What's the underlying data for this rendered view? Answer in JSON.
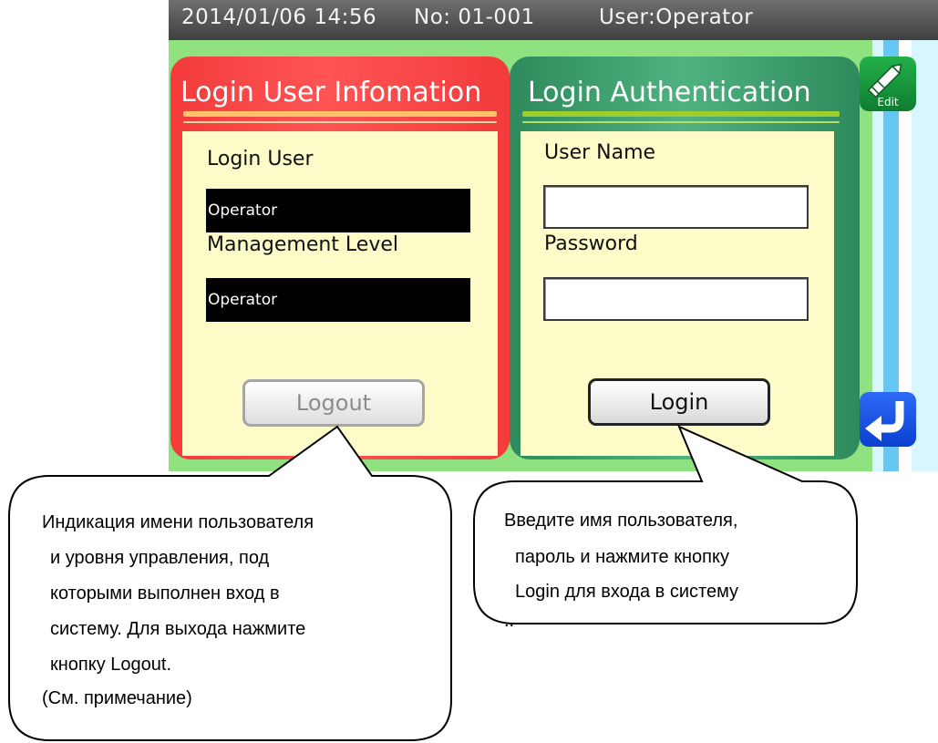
{
  "status_bar": {
    "datetime": "2014/01/06 14:56",
    "number": "No: 01-001",
    "user": "User:Operator"
  },
  "user_info_panel": {
    "title": "Login User Infomation",
    "login_user_label": "Login User",
    "login_user_value": "Operator",
    "management_level_label": "Management Level",
    "management_level_value": "Operator",
    "logout_button": "Logout"
  },
  "auth_panel": {
    "title": "Login Authentication",
    "user_name_label": "User Name",
    "user_name_value": "",
    "password_label": "Password",
    "password_value": "",
    "login_button": "Login"
  },
  "side_buttons": {
    "edit_label": "Edit",
    "edit_icon": "pencil-icon",
    "back_icon": "return-arrow-icon"
  },
  "callouts": {
    "left": {
      "lines": [
        "Индикация имени пользователя",
        "и уровня управления, под",
        "которыми выполнен вход в",
        "систему. Для выхода нажмите",
        "кнопку Logout.",
        "(См. примечание)"
      ]
    },
    "right": {
      "lines": [
        "Введите имя пользователя,",
        "пароль и нажмите  кнопку",
        "Login для входа в систему",
        ".."
      ]
    }
  },
  "colors": {
    "status_bar": "#4f4f4f",
    "screen_background": "#8fe27f",
    "user_panel": "#f33b3b",
    "auth_panel": "#2e8a5c",
    "panel_body": "#fdfbc8",
    "edit_button": "#17963d",
    "back_button": "#1a52e6"
  }
}
